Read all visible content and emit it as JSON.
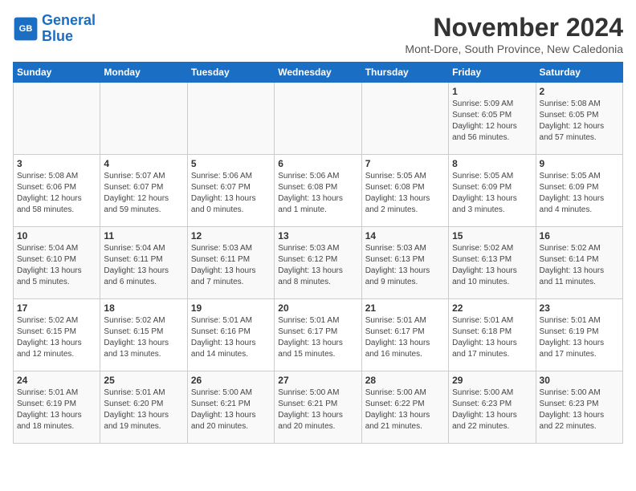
{
  "header": {
    "logo_line1": "General",
    "logo_line2": "Blue",
    "month_year": "November 2024",
    "location": "Mont-Dore, South Province, New Caledonia"
  },
  "days_of_week": [
    "Sunday",
    "Monday",
    "Tuesday",
    "Wednesday",
    "Thursday",
    "Friday",
    "Saturday"
  ],
  "weeks": [
    [
      {
        "day": "",
        "detail": ""
      },
      {
        "day": "",
        "detail": ""
      },
      {
        "day": "",
        "detail": ""
      },
      {
        "day": "",
        "detail": ""
      },
      {
        "day": "",
        "detail": ""
      },
      {
        "day": "1",
        "detail": "Sunrise: 5:09 AM\nSunset: 6:05 PM\nDaylight: 12 hours and 56 minutes."
      },
      {
        "day": "2",
        "detail": "Sunrise: 5:08 AM\nSunset: 6:05 PM\nDaylight: 12 hours and 57 minutes."
      }
    ],
    [
      {
        "day": "3",
        "detail": "Sunrise: 5:08 AM\nSunset: 6:06 PM\nDaylight: 12 hours and 58 minutes."
      },
      {
        "day": "4",
        "detail": "Sunrise: 5:07 AM\nSunset: 6:07 PM\nDaylight: 12 hours and 59 minutes."
      },
      {
        "day": "5",
        "detail": "Sunrise: 5:06 AM\nSunset: 6:07 PM\nDaylight: 13 hours and 0 minutes."
      },
      {
        "day": "6",
        "detail": "Sunrise: 5:06 AM\nSunset: 6:08 PM\nDaylight: 13 hours and 1 minute."
      },
      {
        "day": "7",
        "detail": "Sunrise: 5:05 AM\nSunset: 6:08 PM\nDaylight: 13 hours and 2 minutes."
      },
      {
        "day": "8",
        "detail": "Sunrise: 5:05 AM\nSunset: 6:09 PM\nDaylight: 13 hours and 3 minutes."
      },
      {
        "day": "9",
        "detail": "Sunrise: 5:05 AM\nSunset: 6:09 PM\nDaylight: 13 hours and 4 minutes."
      }
    ],
    [
      {
        "day": "10",
        "detail": "Sunrise: 5:04 AM\nSunset: 6:10 PM\nDaylight: 13 hours and 5 minutes."
      },
      {
        "day": "11",
        "detail": "Sunrise: 5:04 AM\nSunset: 6:11 PM\nDaylight: 13 hours and 6 minutes."
      },
      {
        "day": "12",
        "detail": "Sunrise: 5:03 AM\nSunset: 6:11 PM\nDaylight: 13 hours and 7 minutes."
      },
      {
        "day": "13",
        "detail": "Sunrise: 5:03 AM\nSunset: 6:12 PM\nDaylight: 13 hours and 8 minutes."
      },
      {
        "day": "14",
        "detail": "Sunrise: 5:03 AM\nSunset: 6:13 PM\nDaylight: 13 hours and 9 minutes."
      },
      {
        "day": "15",
        "detail": "Sunrise: 5:02 AM\nSunset: 6:13 PM\nDaylight: 13 hours and 10 minutes."
      },
      {
        "day": "16",
        "detail": "Sunrise: 5:02 AM\nSunset: 6:14 PM\nDaylight: 13 hours and 11 minutes."
      }
    ],
    [
      {
        "day": "17",
        "detail": "Sunrise: 5:02 AM\nSunset: 6:15 PM\nDaylight: 13 hours and 12 minutes."
      },
      {
        "day": "18",
        "detail": "Sunrise: 5:02 AM\nSunset: 6:15 PM\nDaylight: 13 hours and 13 minutes."
      },
      {
        "day": "19",
        "detail": "Sunrise: 5:01 AM\nSunset: 6:16 PM\nDaylight: 13 hours and 14 minutes."
      },
      {
        "day": "20",
        "detail": "Sunrise: 5:01 AM\nSunset: 6:17 PM\nDaylight: 13 hours and 15 minutes."
      },
      {
        "day": "21",
        "detail": "Sunrise: 5:01 AM\nSunset: 6:17 PM\nDaylight: 13 hours and 16 minutes."
      },
      {
        "day": "22",
        "detail": "Sunrise: 5:01 AM\nSunset: 6:18 PM\nDaylight: 13 hours and 17 minutes."
      },
      {
        "day": "23",
        "detail": "Sunrise: 5:01 AM\nSunset: 6:19 PM\nDaylight: 13 hours and 17 minutes."
      }
    ],
    [
      {
        "day": "24",
        "detail": "Sunrise: 5:01 AM\nSunset: 6:19 PM\nDaylight: 13 hours and 18 minutes."
      },
      {
        "day": "25",
        "detail": "Sunrise: 5:01 AM\nSunset: 6:20 PM\nDaylight: 13 hours and 19 minutes."
      },
      {
        "day": "26",
        "detail": "Sunrise: 5:00 AM\nSunset: 6:21 PM\nDaylight: 13 hours and 20 minutes."
      },
      {
        "day": "27",
        "detail": "Sunrise: 5:00 AM\nSunset: 6:21 PM\nDaylight: 13 hours and 20 minutes."
      },
      {
        "day": "28",
        "detail": "Sunrise: 5:00 AM\nSunset: 6:22 PM\nDaylight: 13 hours and 21 minutes."
      },
      {
        "day": "29",
        "detail": "Sunrise: 5:00 AM\nSunset: 6:23 PM\nDaylight: 13 hours and 22 minutes."
      },
      {
        "day": "30",
        "detail": "Sunrise: 5:00 AM\nSunset: 6:23 PM\nDaylight: 13 hours and 22 minutes."
      }
    ]
  ]
}
